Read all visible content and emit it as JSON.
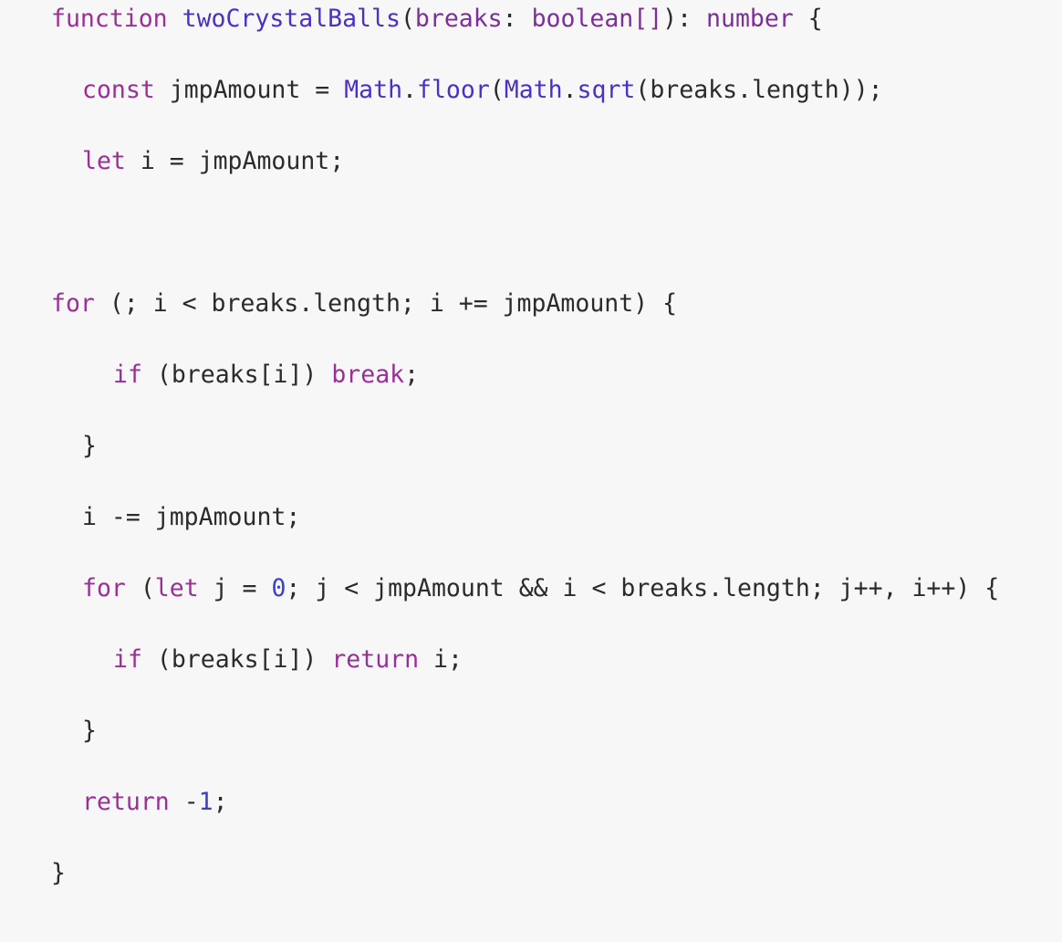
{
  "window": {
    "background": "#f7f7f7"
  },
  "colors": {
    "keyword": "#9a2f97",
    "function": "#4b2fc7",
    "type": "#7c2f97",
    "number": "#3a41c9",
    "text": "#2b2b2b"
  },
  "code": {
    "language": "typescript",
    "lines": [
      {
        "tokens": [
          {
            "kind": "kw",
            "text": "function"
          },
          {
            "kind": "plain",
            "text": " "
          },
          {
            "kind": "fn",
            "text": "twoCrystalBalls"
          },
          {
            "kind": "plain",
            "text": "("
          },
          {
            "kind": "ty",
            "text": "breaks"
          },
          {
            "kind": "plain",
            "text": ": "
          },
          {
            "kind": "ty",
            "text": "boolean[]"
          },
          {
            "kind": "plain",
            "text": "): "
          },
          {
            "kind": "ty",
            "text": "number"
          },
          {
            "kind": "plain",
            "text": " {"
          }
        ]
      },
      {
        "tokens": [
          {
            "kind": "kw",
            "text": "const"
          },
          {
            "kind": "plain",
            "text": " jmpAmount = "
          },
          {
            "kind": "fn",
            "text": "Math"
          },
          {
            "kind": "plain",
            "text": "."
          },
          {
            "kind": "fn",
            "text": "floor"
          },
          {
            "kind": "plain",
            "text": "("
          },
          {
            "kind": "fn",
            "text": "Math"
          },
          {
            "kind": "plain",
            "text": "."
          },
          {
            "kind": "fn",
            "text": "sqrt"
          },
          {
            "kind": "plain",
            "text": "(breaks.length));"
          }
        ]
      },
      {
        "tokens": [
          {
            "kind": "kw",
            "text": "let"
          },
          {
            "kind": "plain",
            "text": " i = jmpAmount;"
          }
        ]
      },
      {
        "tokens": []
      },
      {
        "tokens": [
          {
            "kind": "kw",
            "text": "for"
          },
          {
            "kind": "plain",
            "text": " (; i < breaks.length; i += jmpAmount) {"
          }
        ]
      },
      {
        "tokens": [
          {
            "kind": "kw",
            "text": "if"
          },
          {
            "kind": "plain",
            "text": " (breaks[i]) "
          },
          {
            "kind": "kw",
            "text": "break"
          },
          {
            "kind": "plain",
            "text": ";"
          }
        ]
      },
      {
        "tokens": [
          {
            "kind": "plain",
            "text": "}"
          }
        ]
      },
      {
        "tokens": [
          {
            "kind": "plain",
            "text": "i -= jmpAmount;"
          }
        ]
      },
      {
        "tokens": [
          {
            "kind": "kw",
            "text": "for"
          },
          {
            "kind": "plain",
            "text": " ("
          },
          {
            "kind": "kw",
            "text": "let"
          },
          {
            "kind": "plain",
            "text": " j = "
          },
          {
            "kind": "num",
            "text": "0"
          },
          {
            "kind": "plain",
            "text": "; j < jmpAmount && i < breaks.length; j++, i++) {"
          }
        ]
      },
      {
        "tokens": [
          {
            "kind": "kw",
            "text": "if"
          },
          {
            "kind": "plain",
            "text": " (breaks[i]) "
          },
          {
            "kind": "kw",
            "text": "return"
          },
          {
            "kind": "plain",
            "text": " i;"
          }
        ]
      },
      {
        "tokens": [
          {
            "kind": "plain",
            "text": "}"
          }
        ]
      },
      {
        "tokens": [
          {
            "kind": "kw",
            "text": "return"
          },
          {
            "kind": "plain",
            "text": " -"
          },
          {
            "kind": "num",
            "text": "1"
          },
          {
            "kind": "plain",
            "text": ";"
          }
        ]
      },
      {
        "tokens": [
          {
            "kind": "plain",
            "text": "}"
          }
        ]
      }
    ]
  }
}
